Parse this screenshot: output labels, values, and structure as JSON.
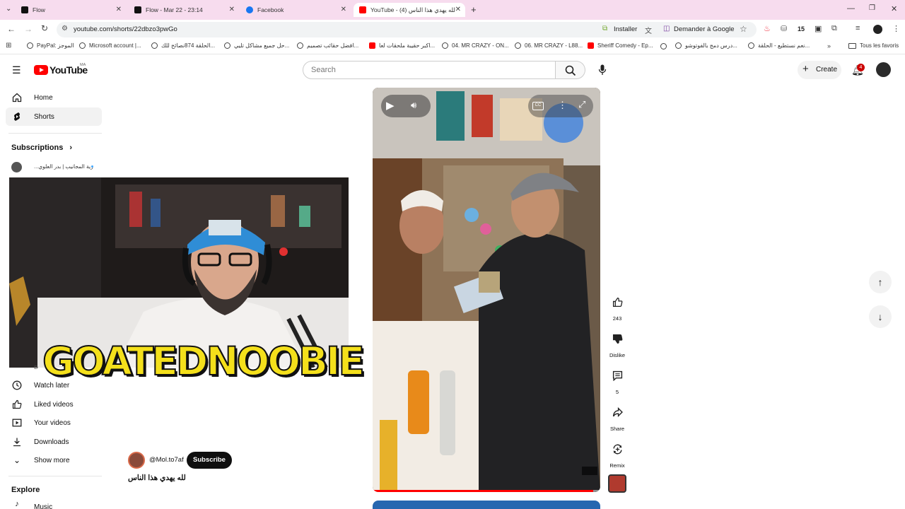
{
  "browser": {
    "tabs": [
      {
        "label": "Flow",
        "active": false
      },
      {
        "label": "Flow - Mar 22 - 23:14",
        "active": false
      },
      {
        "label": "Facebook",
        "active": false
      },
      {
        "label": "YouTube - (4) لله يهدي هذا الناس",
        "active": true
      }
    ],
    "new_tab": "+",
    "url": "youtube.com/shorts/22dbzo3pwGo",
    "install_label": "Installer",
    "ask_google_label": "Demander à Google",
    "extension_count": "15",
    "bookmarks": [
      "PayPal: الموجز",
      "Microsoft account |...",
      "الحلقة 874نصائح للك...",
      "حل جميع مشاكل تليي...",
      "افضل حقائب تصميم...",
      "اكبر حقيبة ملحقات لعا...",
      "04. MR CRAZY - ON...",
      "06. MR CRAZY - L88...",
      "Sheriff Comedy - Ep...",
      "درس دمج بالفوتوشو...",
      "نعم نستطيع - الحلقة..."
    ],
    "all_bookmarks": "Tous les favoris"
  },
  "youtube": {
    "logo": "YouTube",
    "country": "MA",
    "search_placeholder": "Search",
    "create_label": "Create",
    "notification_count": "4",
    "sidebar": {
      "home": "Home",
      "shorts": "Shorts",
      "subscriptions": "Subscriptions",
      "subscription_channel": "...رية المجانيب | بدر العلوي",
      "watch_later": "Watch later",
      "liked_videos": "Liked videos",
      "your_videos": "Your videos",
      "downloads": "Downloads",
      "show_more": "Show more",
      "explore": "Explore",
      "music": "Music"
    },
    "overlay_text": "GOATEDNOOBIE",
    "short": {
      "channel": "@Mol.to7af",
      "subscribe": "Subscribe",
      "title": "لله يهدي هذا الناس",
      "like_count": "243",
      "dislike_label": "Dislike",
      "comment_count": "5",
      "share_label": "Share",
      "remix_label": "Remix",
      "cc_label": "CC",
      "progress": 0.97
    }
  },
  "colors": {
    "accent": "#ff0000",
    "tabbar": "#f7dcee"
  }
}
